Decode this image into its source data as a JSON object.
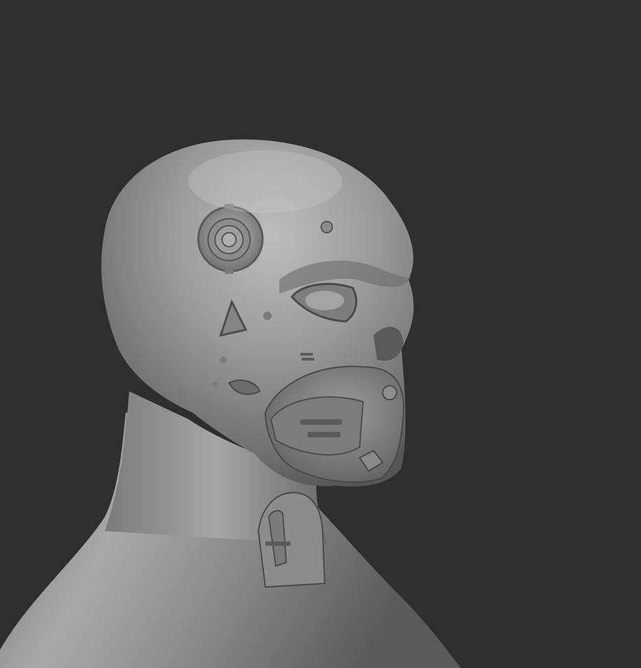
{
  "scene": {
    "background_color": "#2e2e2e",
    "model_base_color": "#8a8a8a",
    "model_highlight_color": "#c2c2c2",
    "model_shadow_color": "#4a4a4a",
    "subject": "cyborg-head-bust-sculpt",
    "material": "matte-gray-clay",
    "view": "three-quarter-right-profile"
  }
}
